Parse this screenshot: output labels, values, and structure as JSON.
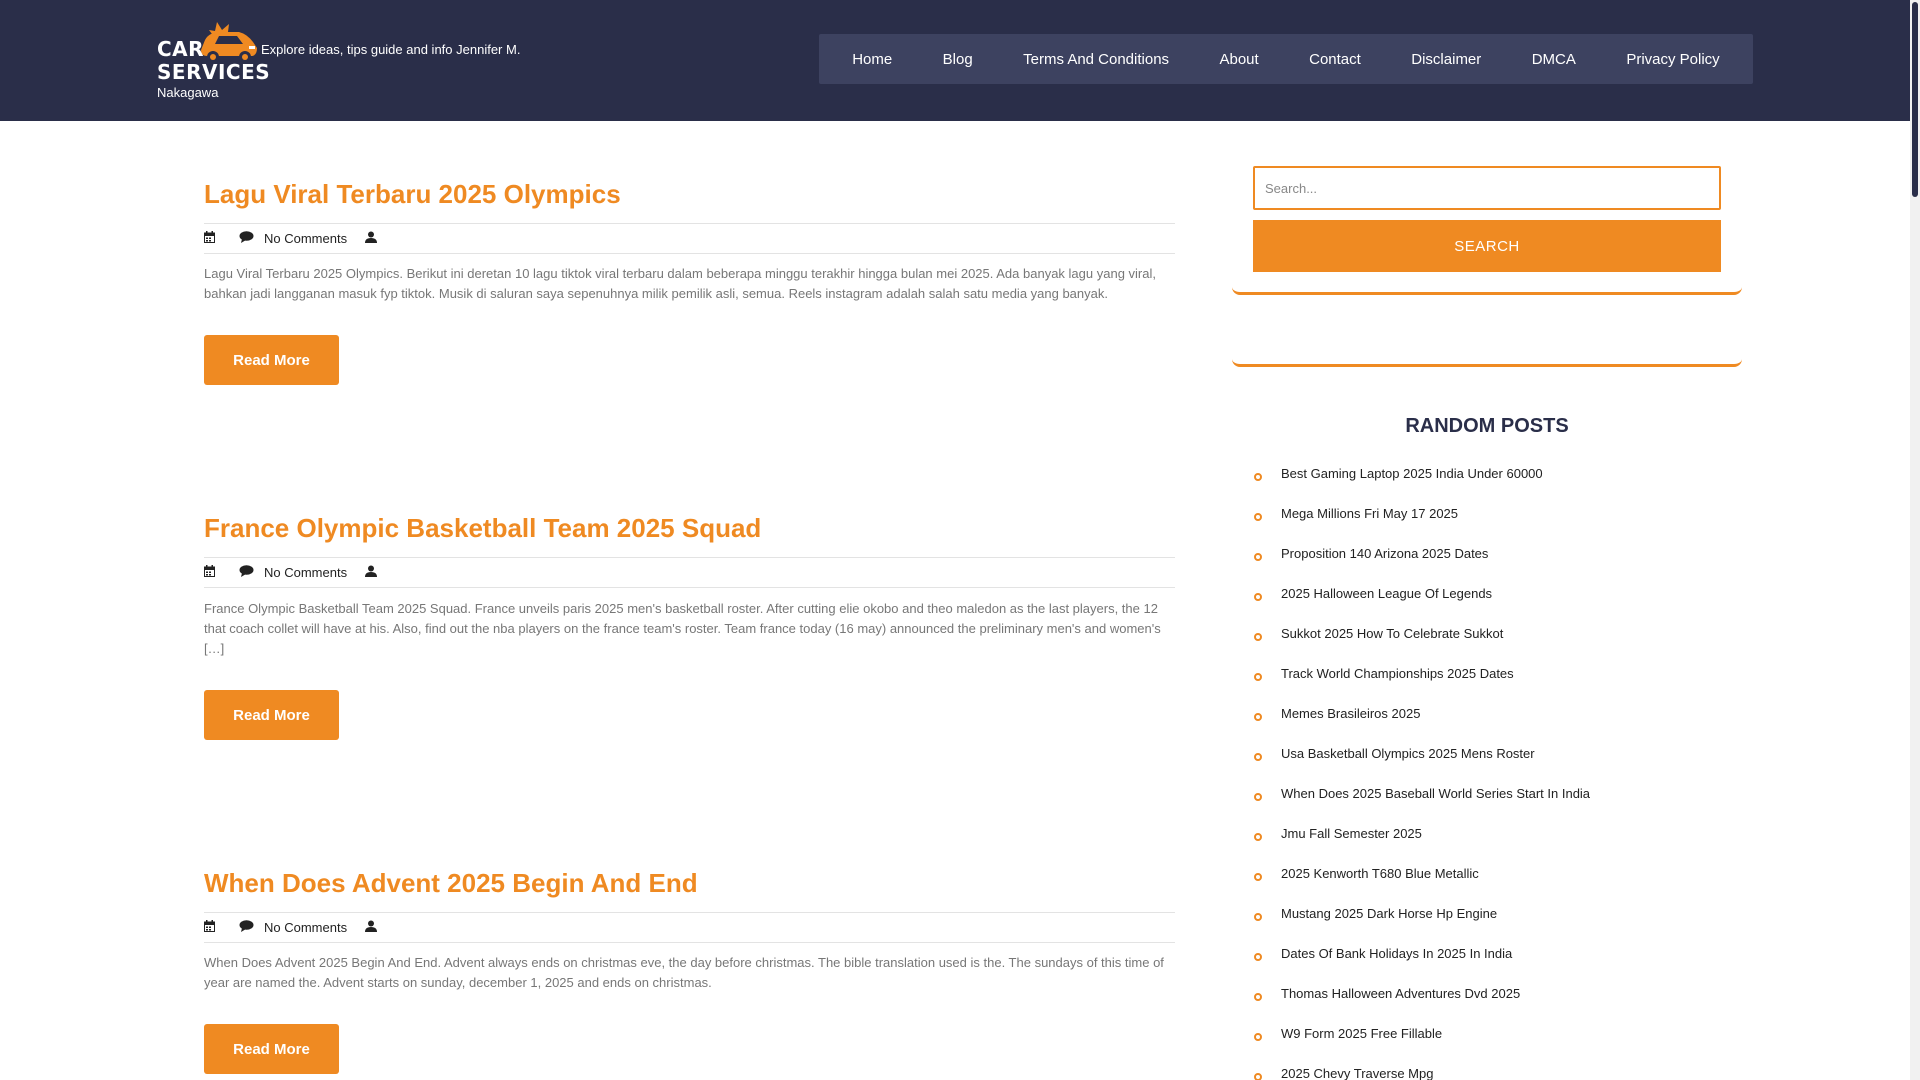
{
  "header": {
    "logo_line1": "CAR",
    "logo_line2": "SERVICES",
    "tagline": "Explore ideas, tips guide and info Jennifer M.",
    "tagline_continued": "Nakagawa",
    "nav": [
      "Home",
      "Blog",
      "Terms And Conditions",
      "About",
      "Contact",
      "Disclaimer",
      "DMCA",
      "Privacy Policy"
    ]
  },
  "posts": [
    {
      "title": "Lagu Viral Terbaru 2025 Olympics",
      "comments": "No Comments",
      "excerpt": "Lagu Viral Terbaru 2025 Olympics. Berikut ini deretan 10 lagu tiktok viral terbaru dalam beberapa minggu terakhir hingga bulan mei 2025. Ada banyak lagu yang viral, bahkan jadi langganan masuk fyp tiktok. Musik di saluran saya sepenuhnya milik pemilik asli, semua. Reels instagram adalah salah satu media yang banyak.",
      "read_more": "Read More"
    },
    {
      "title": "France Olympic Basketball Team 2025 Squad",
      "comments": "No Comments",
      "excerpt": "France Olympic Basketball Team 2025 Squad. France unveils paris 2025 men's basketball roster. After cutting elie okobo and theo maledon as the last players, the 12 that coach collet will have at his. Also, find out the nba players on the france team's roster. Team france today (16 may) announced the preliminary men's and women's […]",
      "read_more": "Read More"
    },
    {
      "title": "When Does Advent 2025 Begin And End",
      "comments": "No Comments",
      "excerpt": "When Does Advent 2025 Begin And End. Advent always ends on christmas eve, the day before christmas. The bible translation used is the. The sundays of this time of year are named the. Advent starts on sunday, december 1, 2025 and ends on christmas.",
      "read_more": "Read More"
    }
  ],
  "sidebar": {
    "search_placeholder": "Search...",
    "search_button": "SEARCH",
    "random_title": "RANDOM POSTS",
    "random_posts": [
      "Best Gaming Laptop 2025 India Under 60000",
      "Mega Millions Fri May 17 2025",
      "Proposition 140 Arizona 2025 Dates",
      "2025 Halloween League Of Legends",
      "Sukkot 2025 How To Celebrate Sukkot",
      "Track World Championships 2025 Dates",
      "Memes Brasileiros 2025",
      "Usa Basketball Olympics 2025 Mens Roster",
      "When Does 2025 Baseball World Series Start In India",
      "Jmu Fall Semester 2025",
      "2025 Kenworth T680 Blue Metallic",
      "Mustang 2025 Dark Horse Hp Engine",
      "Dates Of Bank Holidays In 2025 In India",
      "Thomas Halloween Adventures Dvd 2025",
      "W9 Form 2025 Free Fillable",
      "2025 Chevy Traverse Mpg"
    ]
  },
  "colors": {
    "header_bg": "#2a2e49",
    "nav_bg": "#3d4260",
    "accent": "#ef8a22"
  }
}
